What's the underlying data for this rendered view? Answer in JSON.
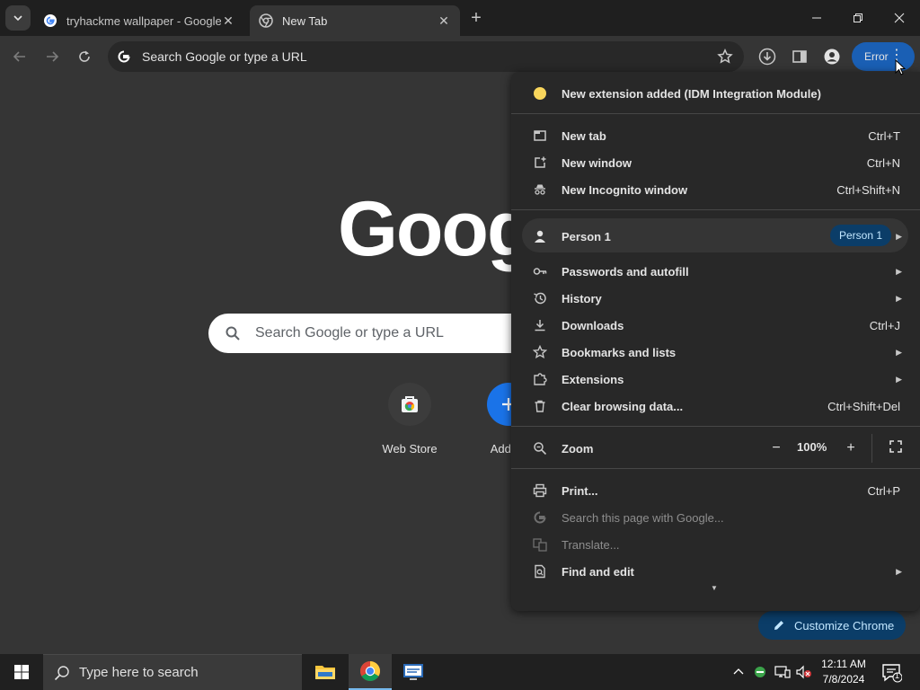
{
  "tabs": [
    {
      "title": "tryhackme wallpaper - Google Search",
      "active": false,
      "icon": "google-g-icon"
    },
    {
      "title": "New Tab",
      "active": true,
      "icon": "chrome-icon"
    }
  ],
  "omnibox": {
    "placeholder": "Search Google or type a URL"
  },
  "profile_error_label": "Error",
  "ntp": {
    "logo": "Goog",
    "search_placeholder": "Search Google or type a URL",
    "shortcuts": [
      {
        "label": "Web Store",
        "icon": "web-store-icon"
      },
      {
        "label": "Add sh",
        "icon": "add-shortcut-icon"
      }
    ],
    "customize_label": "Customize Chrome"
  },
  "menu": {
    "notice": "New extension added (IDM Integration Module)",
    "group1": [
      {
        "label": "New tab",
        "shortcut": "Ctrl+T",
        "icon": "new-tab-icon"
      },
      {
        "label": "New window",
        "shortcut": "Ctrl+N",
        "icon": "new-window-icon"
      },
      {
        "label": "New Incognito window",
        "shortcut": "Ctrl+Shift+N",
        "icon": "incognito-icon"
      }
    ],
    "person": {
      "label": "Person 1",
      "badge": "Person 1"
    },
    "group2": [
      {
        "label": "Passwords and autofill",
        "shortcut": "",
        "submenu": true,
        "icon": "key-icon"
      },
      {
        "label": "History",
        "shortcut": "",
        "submenu": true,
        "icon": "history-icon"
      },
      {
        "label": "Downloads",
        "shortcut": "Ctrl+J",
        "submenu": false,
        "icon": "download-icon"
      },
      {
        "label": "Bookmarks and lists",
        "shortcut": "",
        "submenu": true,
        "icon": "star-icon"
      },
      {
        "label": "Extensions",
        "shortcut": "",
        "submenu": true,
        "icon": "puzzle-icon"
      },
      {
        "label": "Clear browsing data...",
        "shortcut": "Ctrl+Shift+Del",
        "submenu": false,
        "icon": "trash-icon"
      }
    ],
    "zoom": {
      "label": "Zoom",
      "value": "100%",
      "minus": "−",
      "plus": "+"
    },
    "group3": [
      {
        "label": "Print...",
        "shortcut": "Ctrl+P",
        "submenu": false,
        "disabled": false,
        "icon": "print-icon"
      },
      {
        "label": "Search this page with Google...",
        "shortcut": "",
        "submenu": false,
        "disabled": true,
        "icon": "google-g-icon"
      },
      {
        "label": "Translate...",
        "shortcut": "",
        "submenu": false,
        "disabled": true,
        "icon": "translate-icon"
      },
      {
        "label": "Find and edit",
        "shortcut": "",
        "submenu": true,
        "disabled": false,
        "icon": "find-icon"
      }
    ]
  },
  "taskbar": {
    "search_placeholder": "Type here to search",
    "time": "12:11 AM",
    "date": "7/8/2024",
    "notification_count": "1"
  }
}
